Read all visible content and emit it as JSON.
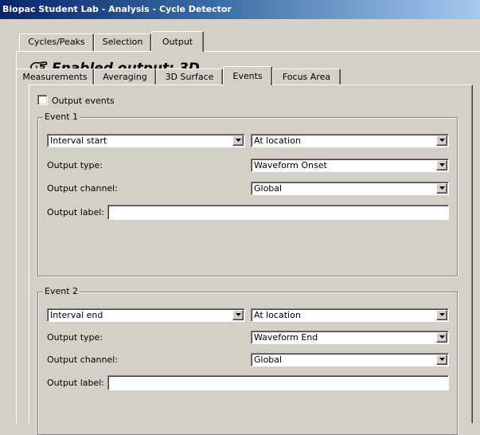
{
  "window": {
    "title": "Biopac Student Lab - Analysis - Cycle Detector"
  },
  "outer_tabs": [
    "Cycles/Peaks",
    "Selection",
    "Output"
  ],
  "outer_active": "Output",
  "header": {
    "text": "Enabled output: 3D",
    "icon": "pointing-hand-icon"
  },
  "inner_tabs": [
    "Measurements",
    "Averaging",
    "3D Surface",
    "Events",
    "Focus Area"
  ],
  "inner_active": "Events",
  "output_events": {
    "label": "Output events",
    "checked": false
  },
  "events": [
    {
      "title": "Event 1",
      "position": "Interval start",
      "location": "At location",
      "output_type_label": "Output type:",
      "output_type": "Waveform Onset",
      "output_channel_label": "Output channel:",
      "output_channel": "Global",
      "output_label_label": "Output label:",
      "output_label": ""
    },
    {
      "title": "Event 2",
      "position": "Interval end",
      "location": "At location",
      "output_type_label": "Output type:",
      "output_type": "Waveform End",
      "output_channel_label": "Output channel:",
      "output_channel": "Global",
      "output_label_label": "Output label:",
      "output_label": ""
    }
  ]
}
